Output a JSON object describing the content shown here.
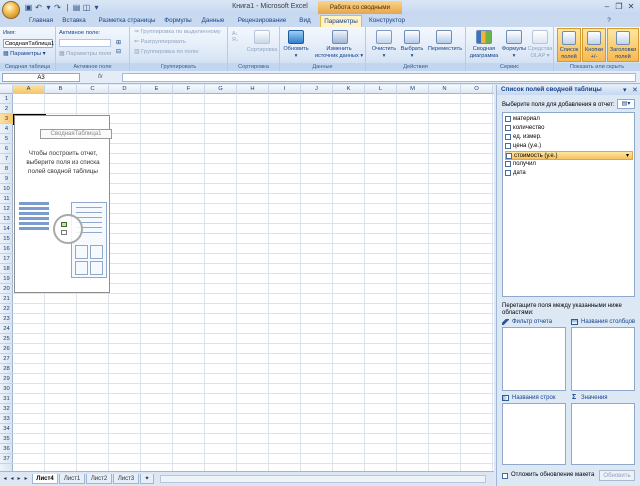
{
  "window": {
    "title": "Книга1 - Microsoft Excel",
    "context_title": "Работа со сводными таблицами"
  },
  "tabs": [
    "Главная",
    "Вставка",
    "Разметка страницы",
    "Формулы",
    "Данные",
    "Рецензирование",
    "Вид",
    "Параметры",
    "Конструктор"
  ],
  "ribbon": {
    "pivot_group": {
      "name_label": "Имя:",
      "name_value": "СводнаяТаблица1",
      "options_btn": "Параметры",
      "label": "Сводная таблица"
    },
    "active_field_group": {
      "title": "Активное поле:",
      "settings_btn": "Параметры поля",
      "label": "Активное поле"
    },
    "group_group": {
      "by_selection": "Группировка по выделенному",
      "ungroup": "Разгруппировать",
      "by_field": "Группировка по полю",
      "label": "Группировать"
    },
    "sort_group": {
      "sort": "Сортировка",
      "label": "Сортировка"
    },
    "data_group": {
      "refresh": "Обновить",
      "change_source_1": "Изменить",
      "change_source_2": "источник данных",
      "label": "Данные"
    },
    "actions_group": {
      "clear": "Очистить",
      "select": "Выбрать",
      "move": "Переместить",
      "label": "Действия"
    },
    "tools_group": {
      "chart_1": "Сводная",
      "chart_2": "диаграмма",
      "formulas": "Формулы",
      "olap_1": "Средства",
      "olap_2": "OLAP",
      "label": "Сервис"
    },
    "show_group": {
      "field_list_1": "Список",
      "field_list_2": "полей",
      "buttons_1": "Кнопки",
      "buttons_2": "+/-",
      "headers_1": "Заголовки",
      "headers_2": "полей",
      "label": "Показать или скрыть"
    }
  },
  "formula_bar": {
    "name_box": "A3",
    "fx": "fx",
    "value": ""
  },
  "grid": {
    "columns": [
      "A",
      "B",
      "C",
      "D",
      "E",
      "F",
      "G",
      "H",
      "I",
      "J",
      "K",
      "L",
      "M",
      "N",
      "O"
    ],
    "rows": [
      "1",
      "2",
      "3",
      "4",
      "5",
      "6",
      "7",
      "8",
      "9",
      "10",
      "11",
      "12",
      "13",
      "14",
      "15",
      "16",
      "17",
      "18",
      "19",
      "20",
      "21",
      "22",
      "23",
      "24",
      "25",
      "26",
      "27",
      "28",
      "29",
      "30",
      "31",
      "32",
      "33",
      "34",
      "35",
      "36",
      "37"
    ],
    "selected_column": "A",
    "selected_row": "3"
  },
  "pivot_placeholder": {
    "name": "СводнаяТаблица1",
    "hint": "Чтобы построить отчет, выберите поля из списка полей сводной таблицы"
  },
  "sheets": [
    "Лист4",
    "Лист1",
    "Лист2",
    "Лист3"
  ],
  "active_sheet": "Лист4",
  "pane": {
    "title": "Список полей сводной таблицы",
    "choose_label": "Выберите поля для добавления в отчет:",
    "fields": [
      "материал",
      "количество",
      "ед. измер.",
      "цена (у.е.)",
      "стоимость (у.е.)",
      "получил",
      "дата"
    ],
    "hovered_field": "стоимость (у.е.)",
    "drag_label": "Перетащите поля между указанными ниже областями:",
    "zones": {
      "filter": "Фильтр отчета",
      "columns": "Названия столбцов",
      "rows": "Названия строк",
      "values": "Значения"
    },
    "defer_label": "Отложить обновление макета",
    "update_btn": "Обновить"
  },
  "colors": {
    "accent": "#15428b",
    "tab_active": "#fff3c7",
    "context": "#e8a54a",
    "highlight": "#f7b950"
  }
}
